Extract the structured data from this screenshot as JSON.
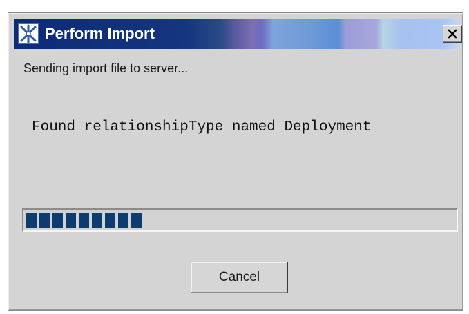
{
  "window": {
    "title": "Perform Import",
    "icon": "app-logo-icon",
    "close_label": "close-icon"
  },
  "status_text": "Sending import file to server...",
  "message_text": "Found relationshipType named Deployment",
  "progress": {
    "fraction": 0.27,
    "style": "segmented",
    "fill_color": "#0d3c6e"
  },
  "buttons": {
    "cancel_label": "Cancel"
  },
  "colors": {
    "dialog_background": "#d4d4d4",
    "title_text": "#ffffff",
    "title_start": "#0c2a78"
  }
}
